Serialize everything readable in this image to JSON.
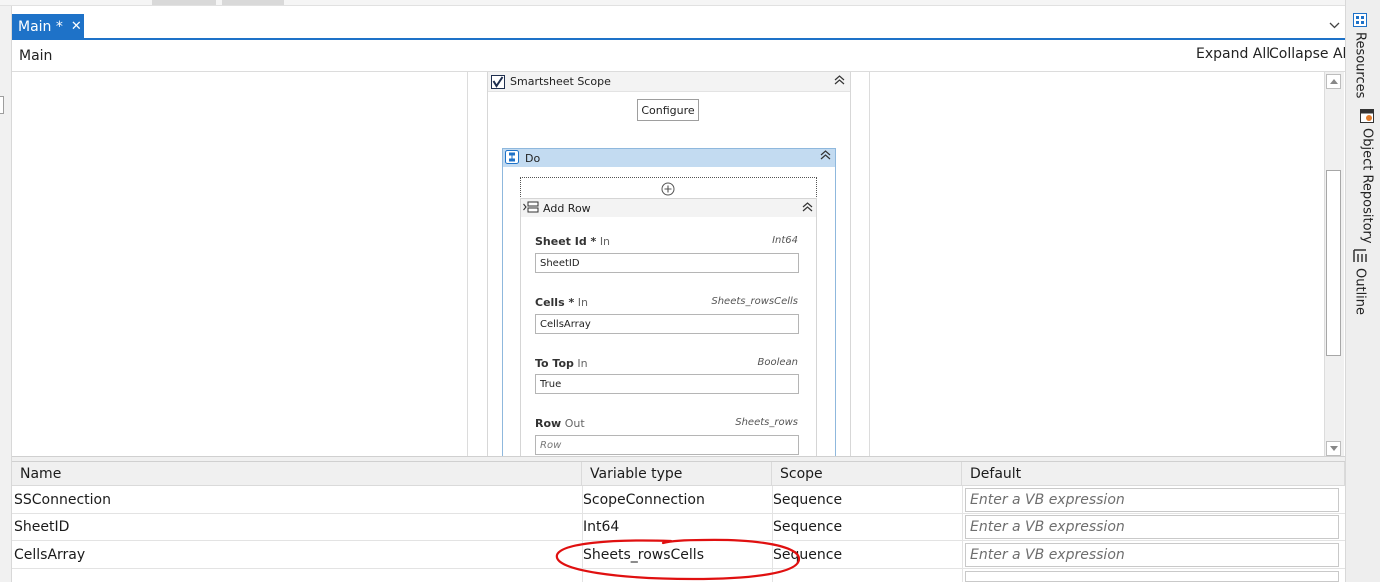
{
  "document_tab": {
    "label": "Main *",
    "close_glyph": "✕",
    "accent": "#1e72c8"
  },
  "breadcrumb": {
    "label": "Main"
  },
  "toolbar": {
    "expand_all": "Expand All",
    "collapse_all": "Collapse All"
  },
  "scope": {
    "title": "Smartsheet Scope",
    "configure_label": "Configure",
    "icon": "smartsheet-check-icon"
  },
  "sequence": {
    "title": "Do",
    "icon": "sequence-icon"
  },
  "add_row": {
    "title": "Add Row",
    "icon": "add-row-icon",
    "properties": [
      {
        "name": "Sheet Id *",
        "direction": "In",
        "type": "Int64",
        "value": "SheetID",
        "placeholder": false
      },
      {
        "name": "Cells *",
        "direction": "In",
        "type": "Sheets_rowsCells",
        "value": "CellsArray",
        "placeholder": false
      },
      {
        "name": "To Top",
        "direction": "In",
        "type": "Boolean",
        "value": "True",
        "placeholder": false
      },
      {
        "name": "Row",
        "direction": "Out",
        "type": "Sheets_rows",
        "value": "Row",
        "placeholder": true
      }
    ]
  },
  "variables": {
    "headers": {
      "name": "Name",
      "type": "Variable type",
      "scope": "Scope",
      "default": "Default"
    },
    "rows": [
      {
        "name": "SSConnection",
        "type": "ScopeConnection",
        "scope": "Sequence",
        "default": "Enter a VB expression"
      },
      {
        "name": "SheetID",
        "type": "Int64",
        "scope": "Sequence",
        "default": "Enter a VB expression"
      },
      {
        "name": "CellsArray",
        "type": "Sheets_rowsCells",
        "scope": "Sequence",
        "default": "Enter a VB expression"
      }
    ],
    "annotation_color": "#e01010"
  },
  "side_panel": {
    "tabs": [
      {
        "label": "Resources",
        "icon": "resources-icon"
      },
      {
        "label": "Object Repository",
        "icon": "object-repository-icon"
      },
      {
        "label": "Outline",
        "icon": "outline-icon"
      }
    ]
  }
}
